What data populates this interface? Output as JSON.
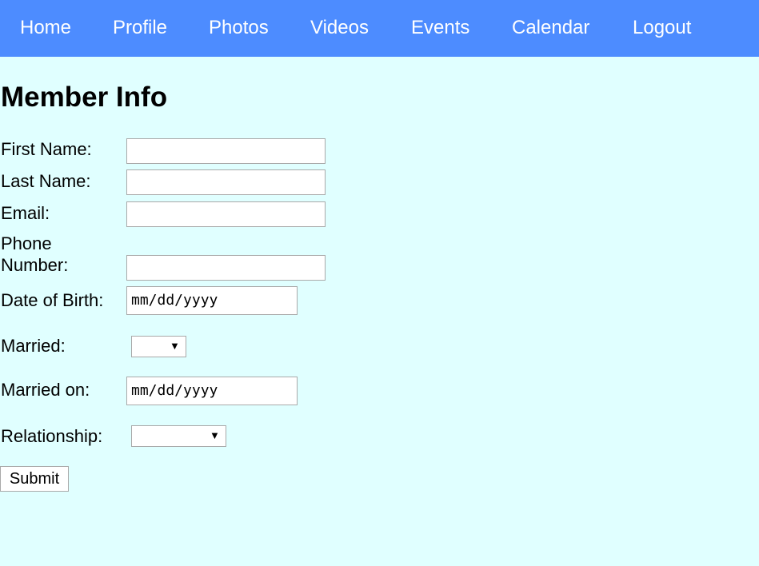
{
  "nav": {
    "items": [
      {
        "label": "Home"
      },
      {
        "label": "Profile"
      },
      {
        "label": "Photos"
      },
      {
        "label": "Videos"
      },
      {
        "label": "Events"
      },
      {
        "label": "Calendar"
      },
      {
        "label": "Logout"
      }
    ],
    "background_color": "#4d8cff",
    "text_color": "#ffffff"
  },
  "page": {
    "title": "Member Info",
    "background_color": "#e0ffff"
  },
  "form": {
    "first_name": {
      "label": "First Name:",
      "value": ""
    },
    "last_name": {
      "label": "Last Name:",
      "value": ""
    },
    "email": {
      "label": "Email:",
      "value": ""
    },
    "phone": {
      "label": "Phone Number:",
      "value": ""
    },
    "dob": {
      "label": "Date of Birth:",
      "placeholder": "mm/dd/yyyy"
    },
    "married": {
      "label": "Married:",
      "selected": ""
    },
    "married_on": {
      "label": "Married on:",
      "placeholder": "mm/dd/yyyy"
    },
    "relationship": {
      "label": "Relationship:",
      "selected": ""
    },
    "submit_label": "Submit"
  },
  "icons": {
    "dropdown_arrow": "▼"
  }
}
